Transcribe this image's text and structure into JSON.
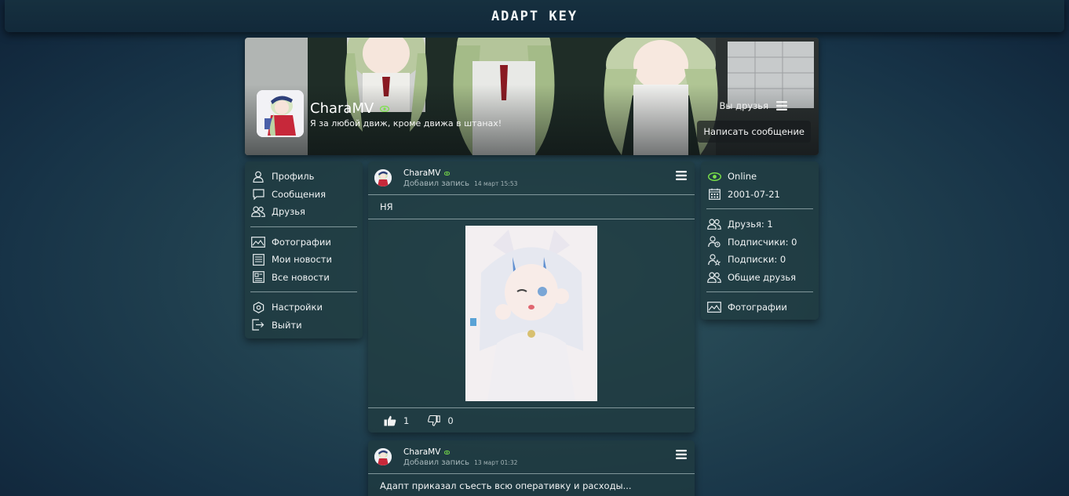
{
  "header": {
    "logo": "ADAPT KEY"
  },
  "profile": {
    "name": "CharaMV",
    "status": "Я за любой движ, кроме движа в штанах!",
    "friend_state": "Вы друзья",
    "message_button": "Написать сообщение",
    "online_color": "#7be24a"
  },
  "left_menu": {
    "group1": [
      {
        "label": "Профиль",
        "icon": "user-icon"
      },
      {
        "label": "Сообщения",
        "icon": "chat-icon"
      },
      {
        "label": "Друзья",
        "icon": "friends-icon"
      }
    ],
    "group2": [
      {
        "label": "Фотографии",
        "icon": "photo-icon"
      },
      {
        "label": "Мои новости",
        "icon": "news-icon"
      },
      {
        "label": "Все новости",
        "icon": "all-news-icon"
      }
    ],
    "group3": [
      {
        "label": "Настройки",
        "icon": "settings-icon"
      },
      {
        "label": "Выйти",
        "icon": "logout-icon"
      }
    ]
  },
  "right_info": {
    "online": "Online",
    "birthdate": "2001-07-21",
    "friends": "Друзья: 1",
    "followers": "Подписчики: 0",
    "following": "Подписки: 0",
    "mutual": "Общие друзья",
    "photos": "Фотографии"
  },
  "posts": [
    {
      "author": "CharaMV",
      "action": "Добавил запись",
      "time": "14 март 15:53",
      "text": "НЯ",
      "likes": "1",
      "dislikes": "0"
    },
    {
      "author": "CharaMV",
      "action": "Добавил запись",
      "time": "13 март 01:32",
      "text": "Адапт приказал съесть всю оперативку и расходы..."
    }
  ]
}
